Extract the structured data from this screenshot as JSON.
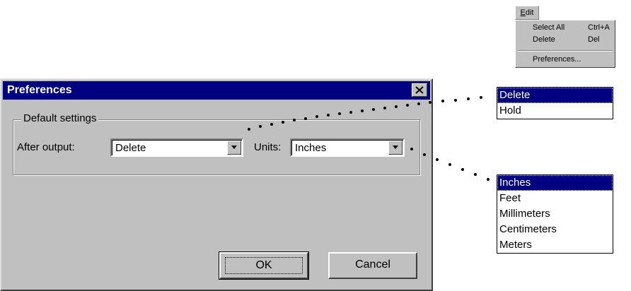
{
  "edit_menu": {
    "title": "Edit",
    "title_mnemonic": "E",
    "title_rest": "dit",
    "items": [
      {
        "label": "Select All",
        "shortcut": "Ctrl+A"
      },
      {
        "label": "Delete",
        "shortcut": "Del"
      }
    ],
    "preferences_label": "Preferences..."
  },
  "dialog": {
    "title": "Preferences",
    "group_title": "Default settings",
    "after_output": {
      "label": "After output:",
      "value": "Delete"
    },
    "units": {
      "label": "Units:",
      "value": "Inches"
    },
    "ok_label": "OK",
    "cancel_label": "Cancel"
  },
  "after_output_options": [
    "Delete",
    "Hold"
  ],
  "units_options": [
    "Inches",
    "Feet",
    "Millimeters",
    "Centimeters",
    "Meters"
  ],
  "colors": {
    "title_bar": "#000080",
    "dialog_face": "#c0c0c0",
    "selection": "#000080"
  },
  "icons": [
    "close-icon",
    "dropdown-arrow-icon"
  ]
}
